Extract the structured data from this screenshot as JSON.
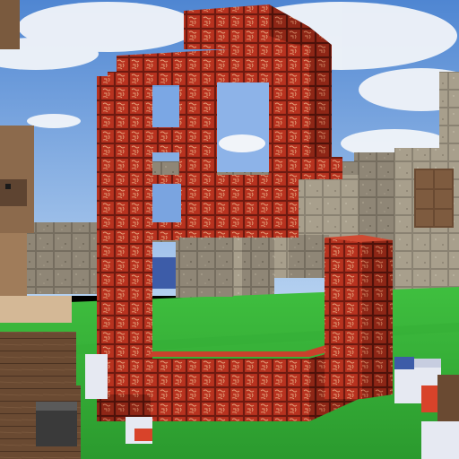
{
  "scene": {
    "type": "voxel-game-render",
    "subject": "red-patterned-block-structure",
    "palette": {
      "sky_top": "#5a8fd6",
      "sky_bottom": "#a9c8ee",
      "cloud": "#f3f5f8",
      "grass": "#39b93a",
      "grass_dark": "#2a8f2c",
      "brick_red": "#b8321f",
      "brick_dark": "#6e1a10",
      "brick_light": "#e0543a",
      "stone": "#8f8676",
      "stone_dark": "#6d6557",
      "stone_light": "#b1a896",
      "wood": "#6a4a32",
      "blue_block": "#3d5ca8",
      "white_block": "#e6e9f2"
    }
  }
}
